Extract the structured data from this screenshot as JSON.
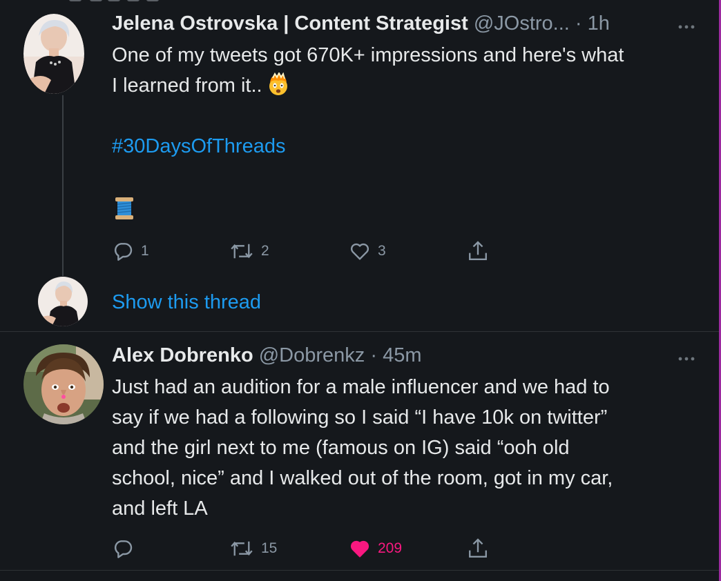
{
  "colors": {
    "background": "#15181c",
    "text": "#e7e9ea",
    "muted": "#8b98a5",
    "link": "#1d9bf0",
    "like": "#f91880",
    "divider": "#2f3336"
  },
  "tweets": [
    {
      "author_name": "Jelena Ostrovska | Content Strategist",
      "handle": "@JOstro...",
      "separator": "·",
      "time": "1h",
      "text_lines": [
        "One of my tweets got 670K+ impressions and here's what",
        "I learned from it.."
      ],
      "inline_emoji": "exploding-head-emoji",
      "hashtag": "#30DaysOfThreads",
      "trailing_emoji": "thread-spool-emoji",
      "actions": {
        "replies": "1",
        "retweets": "2",
        "likes": "3"
      },
      "show_thread": "Show this thread",
      "liked": false
    },
    {
      "author_name": "Alex Dobrenko",
      "handle": "@Dobrenkz",
      "separator": "·",
      "time": "45m",
      "text_lines": [
        "Just had an audition for a male influencer and we had to",
        "say if we had a following so I said “I have 10k on twitter”",
        "and the girl next to me (famous on IG) said “ooh old",
        "school, nice” and I walked out of the room, got in my car,",
        "and left LA"
      ],
      "actions": {
        "replies": "",
        "retweets": "15",
        "likes": "209"
      },
      "liked": true
    }
  ],
  "icons": {
    "more": "more-horizontal-icon",
    "reply": "reply-icon",
    "retweet": "retweet-icon",
    "like": "heart-icon",
    "share": "share-icon"
  }
}
